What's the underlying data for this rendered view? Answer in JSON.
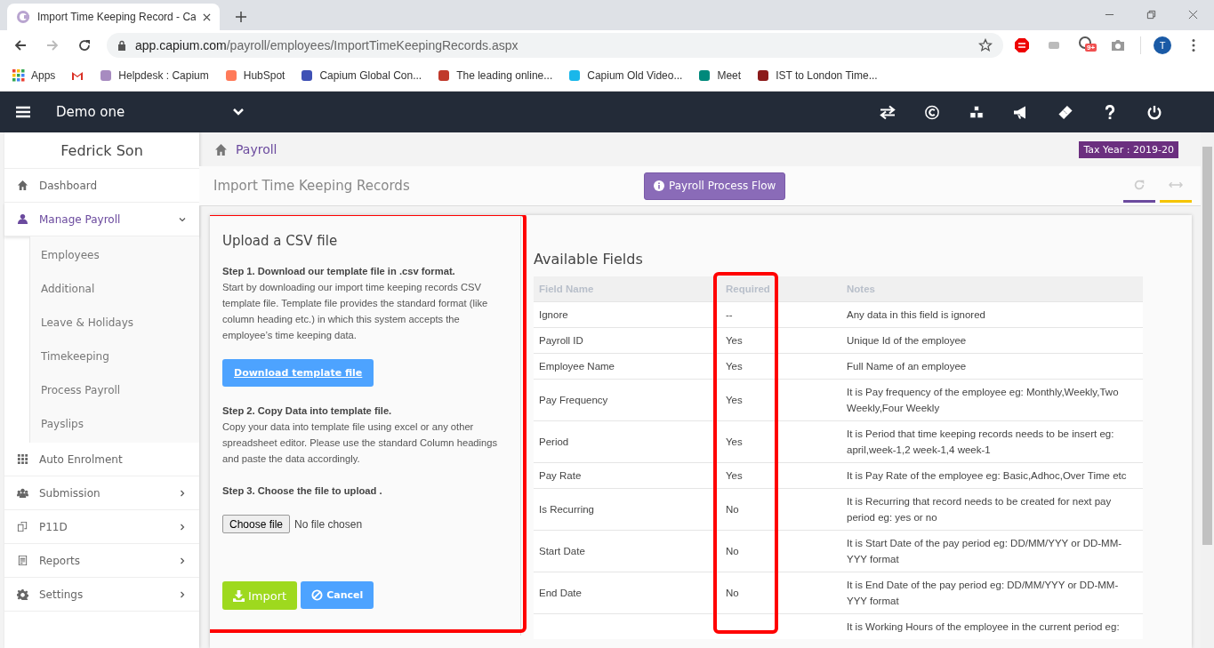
{
  "browser": {
    "tab_title": "Import Time Keeping Record - Ca",
    "url_host": "app.capium.com",
    "url_path": "/payroll/employees/ImportTimeKeepingRecords.aspx",
    "extension_badge": "9+",
    "profile_initial": "T",
    "bookmarks": [
      {
        "label": "Apps",
        "kind": "apps"
      },
      {
        "kind": "gmail"
      },
      {
        "label": "Helpdesk : Capium",
        "kind": "capium"
      },
      {
        "label": "HubSpot",
        "kind": "hubspot"
      },
      {
        "label": "Capium Global Con...",
        "kind": "doc"
      },
      {
        "label": "The leading online...",
        "kind": "aw"
      },
      {
        "label": "Capium Old Video...",
        "kind": "vimeo"
      },
      {
        "label": "Meet",
        "kind": "meet"
      },
      {
        "label": "IST to London Time...",
        "kind": "clock"
      }
    ]
  },
  "header": {
    "company": "Demo one"
  },
  "sidebar": {
    "user": "Fedrick Son",
    "items": [
      {
        "label": "Dashboard",
        "selected": false
      },
      {
        "label": "Manage Payroll",
        "selected": true,
        "expanded": true,
        "children": [
          {
            "label": "Employees"
          },
          {
            "label": "Additional"
          },
          {
            "label": "Leave & Holidays"
          },
          {
            "label": "Timekeeping"
          },
          {
            "label": "Process Payroll"
          },
          {
            "label": "Payslips"
          }
        ]
      },
      {
        "label": "Auto Enrolment",
        "selected": false
      },
      {
        "label": "Submission",
        "selected": false,
        "expanded": false
      },
      {
        "label": "P11D",
        "selected": false,
        "expanded": false
      },
      {
        "label": "Reports",
        "selected": false,
        "expanded": false
      },
      {
        "label": "Settings",
        "selected": false,
        "expanded": false
      }
    ]
  },
  "breadcrumb": "Payroll",
  "tax_year": "Tax Year : 2019-20",
  "page_title": "Import Time Keeping Records",
  "process_flow_button": "Payroll Process Flow",
  "upload": {
    "title": "Upload a CSV file",
    "step1_heading": "Step 1. Download our template file in .csv format.",
    "step1_text": "Start by downloading our import time keeping records CSV template file. Template file provides the standard format (like column heading etc.) in which this system accepts the employee’s time keeping data.",
    "download_button": "Download template file",
    "step2_heading": "Step 2. Copy Data into template file.",
    "step2_text": "Copy your data into template file using excel or any other spreadsheet editor. Please use the standard Column headings and paste the data accordingly.",
    "step3_heading": "Step 3. Choose the file to upload .",
    "choose_button": "Choose file",
    "file_status": "No file chosen",
    "import_button": "Import",
    "cancel_button": "Cancel"
  },
  "fields": {
    "title": "Available Fields",
    "columns": [
      "Field Name",
      "Required",
      "Notes"
    ],
    "rows": [
      [
        "Ignore",
        "--",
        "Any data in this field is ignored"
      ],
      [
        "Payroll ID",
        "Yes",
        "Unique Id of the employee"
      ],
      [
        "Employee Name",
        "Yes",
        "Full Name of an employee"
      ],
      [
        "Pay Frequency",
        "Yes",
        "It is Pay frequency of the employee eg: Monthly,Weekly,Two Weekly,Four Weekly"
      ],
      [
        "Period",
        "Yes",
        "It is Period that time keeping records needs to be insert eg: april,week-1,2 week-1,4 week-1"
      ],
      [
        "Pay Rate",
        "Yes",
        "It is Pay Rate of the employee eg: Basic,Adhoc,Over Time etc"
      ],
      [
        "Is Recurring",
        "No",
        "It is Recurring that record needs to be created for next pay period eg: yes or no"
      ],
      [
        "Start Date",
        "No",
        "It is Start Date of the pay period eg: DD/MM/YYY or DD-MM-YYY format"
      ],
      [
        "End Date",
        "No",
        "It is End Date of the pay period eg: DD/MM/YYY or DD-MM-YYY format"
      ],
      [
        "",
        "",
        "It is Working Hours of the employee in the current period eg:"
      ]
    ]
  }
}
